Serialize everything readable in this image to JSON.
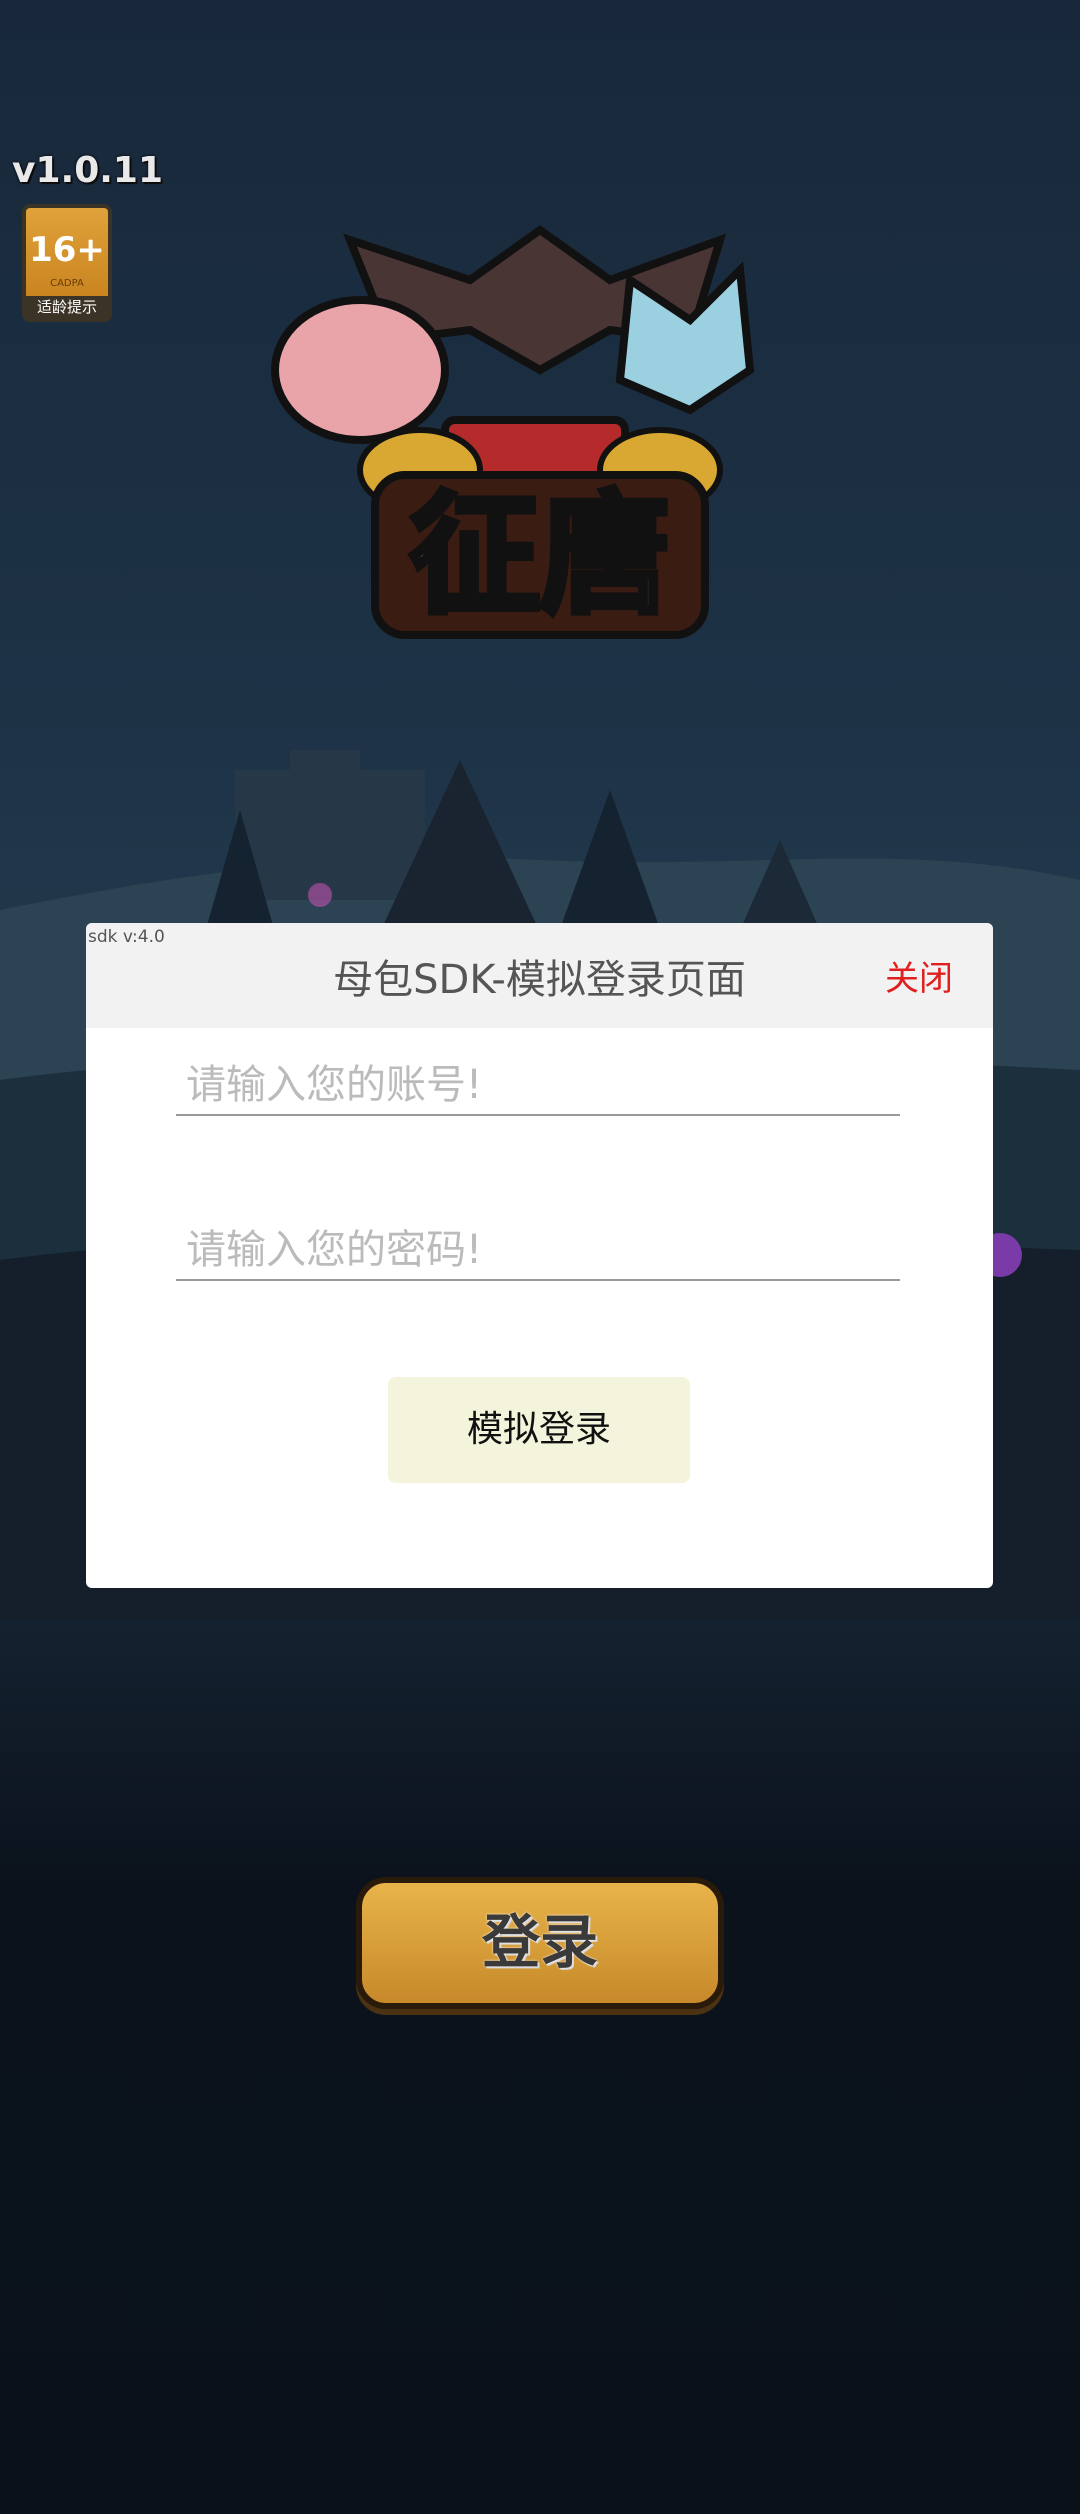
{
  "hud": {
    "version": "v1.0.11",
    "age_rating": "16+",
    "age_org": "CADPA",
    "age_tip": "适龄提示"
  },
  "logo": {
    "title": "征唐"
  },
  "dialog": {
    "sdk_version": "sdk v:4.0",
    "title": "母包SDK-模拟登录页面",
    "close_label": "关闭",
    "account_placeholder": "请输入您的账号!",
    "account_value": "",
    "password_placeholder": "请输入您的密码!",
    "password_value": "",
    "submit_label": "模拟登录"
  },
  "game": {
    "login_label": "登录"
  },
  "colors": {
    "close": "#e02020",
    "submit_bg": "#f4f4dc",
    "game_button": "#d49a36"
  }
}
